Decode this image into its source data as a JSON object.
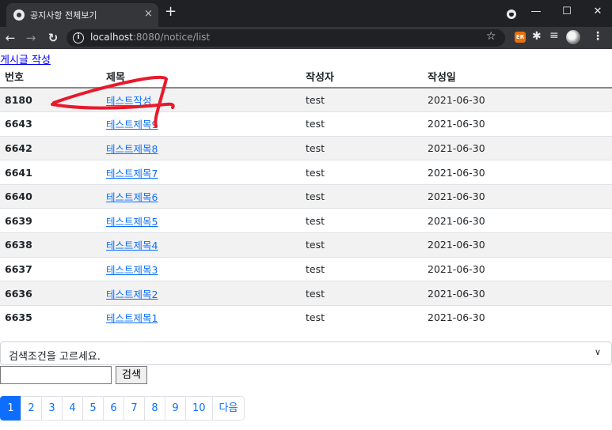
{
  "browser": {
    "tab_title": "공지사항 전체보기",
    "tab_close": "×",
    "new_tab": "+",
    "url_host": "localhost",
    "url_rest": ":8080/notice/list",
    "window_controls": {
      "minimize": "—",
      "maximize": "☐",
      "close": "✕"
    },
    "icons": [
      "back-arrow-icon",
      "forward-arrow-icon",
      "reload-icon",
      "info-icon",
      "star-icon",
      "extension-icon",
      "puzzle-icon",
      "reading-list-icon",
      "avatar",
      "menu-icon"
    ]
  },
  "page": {
    "write_link": "게시글 작성",
    "table": {
      "headers": {
        "no": "번호",
        "title": "제목",
        "writer": "작성자",
        "date": "작성일"
      },
      "rows": [
        {
          "no": "8180",
          "title": "테스트작성",
          "writer": "test",
          "date": "2021-06-30"
        },
        {
          "no": "6643",
          "title": "테스트제목9",
          "writer": "test",
          "date": "2021-06-30"
        },
        {
          "no": "6642",
          "title": "테스트제목8",
          "writer": "test",
          "date": "2021-06-30"
        },
        {
          "no": "6641",
          "title": "테스트제목7",
          "writer": "test",
          "date": "2021-06-30"
        },
        {
          "no": "6640",
          "title": "테스트제목6",
          "writer": "test",
          "date": "2021-06-30"
        },
        {
          "no": "6639",
          "title": "테스트제목5",
          "writer": "test",
          "date": "2021-06-30"
        },
        {
          "no": "6638",
          "title": "테스트제목4",
          "writer": "test",
          "date": "2021-06-30"
        },
        {
          "no": "6637",
          "title": "테스트제목3",
          "writer": "test",
          "date": "2021-06-30"
        },
        {
          "no": "6636",
          "title": "테스트제목2",
          "writer": "test",
          "date": "2021-06-30"
        },
        {
          "no": "6635",
          "title": "테스트제목1",
          "writer": "test",
          "date": "2021-06-30"
        }
      ]
    },
    "search": {
      "select_label": "검색조건을 고르세요.",
      "input_value": "",
      "button_label": "검색"
    },
    "pagination": {
      "pages": [
        "1",
        "2",
        "3",
        "4",
        "5",
        "6",
        "7",
        "8",
        "9",
        "10"
      ],
      "active_page": "1",
      "next_label": "다음"
    },
    "colors": {
      "link": "#0d6efd",
      "annotation": "#e8192c",
      "active_page": "#0d6efd"
    }
  }
}
